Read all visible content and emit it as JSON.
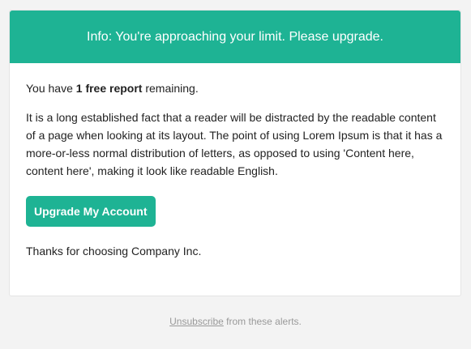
{
  "header": {
    "message": "Info: You're approaching your limit. Please upgrade."
  },
  "body": {
    "intro_prefix": "You have ",
    "intro_strong": "1 free report",
    "intro_suffix": " remaining.",
    "paragraph": "It is a long established fact that a reader will be distracted by the readable content of a page when looking at its layout. The point of using Lorem Ipsum is that it has a more-or-less normal distribution of letters, as opposed to using 'Content here, content here', making it look like readable English.",
    "button_label": "Upgrade My Account",
    "thanks": "Thanks for choosing Company Inc."
  },
  "footer": {
    "link_label": "Unsubscribe",
    "suffix": " from these alerts."
  },
  "colors": {
    "accent": "#1eb394",
    "background": "#f3f3f3",
    "footer_text": "#999999"
  }
}
